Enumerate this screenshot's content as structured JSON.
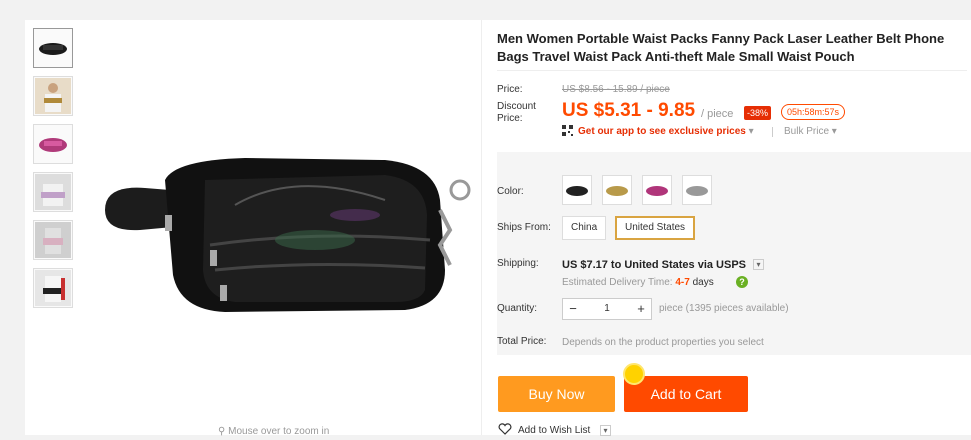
{
  "product": {
    "title": "Men Women Portable Waist Packs Fanny Pack Laser Leather Belt Phone Bags Travel Waist Pack Anti-theft Male Small Waist Pouch",
    "zoom_hint": "Mouse over to zoom in",
    "thumbnail_count": 6
  },
  "price": {
    "price_label": "Price:",
    "original": "US $8.56 - 15.89 / piece",
    "discount_label": "Discount Price:",
    "current": "US $5.31 - 9.85",
    "unit": "/ piece",
    "discount_badge": "-38%",
    "timer": "05h:58m:57s",
    "app_link": "Get our app to see exclusive prices",
    "bulk_price": "Bulk Price"
  },
  "options": {
    "color_label": "Color:",
    "color_swatches": [
      "black",
      "gold",
      "pink",
      "silver"
    ],
    "ships_from_label": "Ships From:",
    "ships_from_options": [
      "China",
      "United States"
    ],
    "ships_from_selected": "United States",
    "shipping_label": "Shipping:",
    "shipping_text": "US $7.17 to United States via USPS",
    "delivery_prefix": "Estimated Delivery Time:",
    "delivery_range": "4-7",
    "delivery_suffix": "days",
    "quantity_label": "Quantity:",
    "quantity_value": "1",
    "quantity_info": "piece (1395 pieces available)",
    "total_label": "Total Price:",
    "total_text": "Depends on the product properties you select"
  },
  "actions": {
    "buy_now": "Buy Now",
    "add_to_cart": "Add to Cart",
    "wish_list": "Add to Wish List"
  },
  "colors": {
    "price": "#ff4a00",
    "buy_now_bg": "#ff9a1f",
    "add_to_cart_bg": "#ff4a00",
    "selected_border": "#d9a441"
  }
}
